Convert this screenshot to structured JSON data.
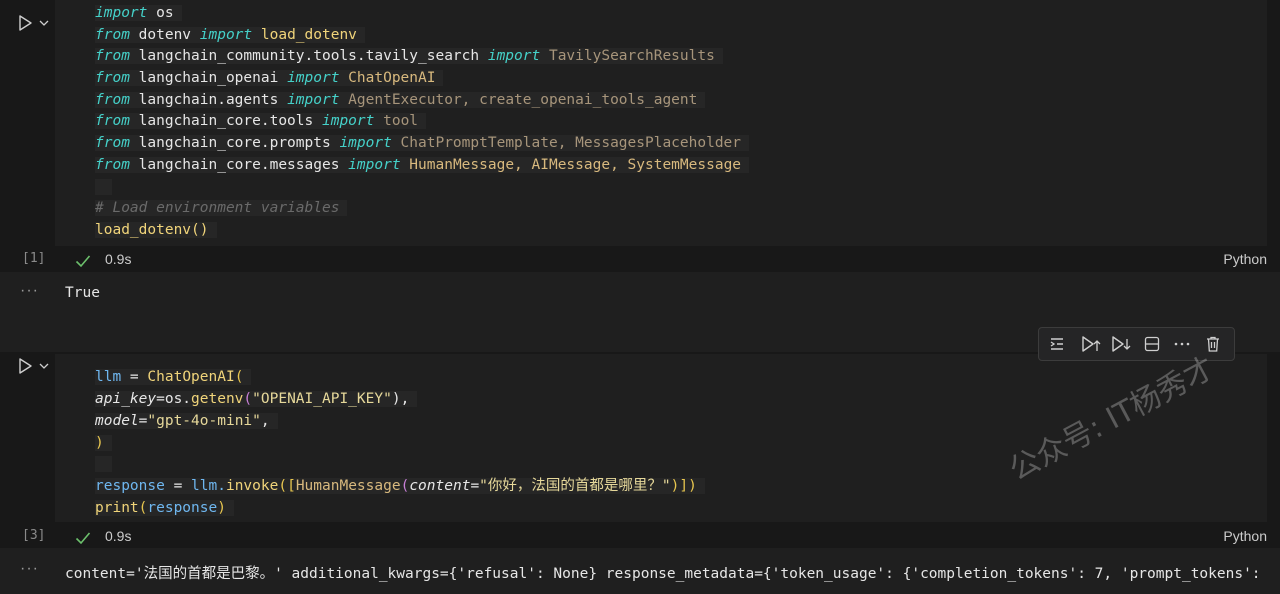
{
  "cell1": {
    "lines": [
      {
        "a": "import",
        "b": " os"
      },
      {
        "a": "from",
        "b": " dotenv ",
        "c": "import",
        "d": " load_dotenv"
      },
      {
        "a": "from",
        "b": " langchain_community.tools.tavily_search ",
        "c": "import",
        "d": " TavilySearchResults"
      },
      {
        "a": "from",
        "b": " langchain_openai ",
        "c": "import",
        "d": " ChatOpenAI"
      },
      {
        "a": "from",
        "b": " langchain.agents ",
        "c": "import",
        "d": " AgentExecutor, create_openai_tools_agent"
      },
      {
        "a": "from",
        "b": " langchain_core.tools ",
        "c": "import",
        "d": " tool"
      },
      {
        "a": "from",
        "b": " langchain_core.prompts ",
        "c": "import",
        "d": " ChatPromptTemplate, MessagesPlaceholder"
      },
      {
        "a": "from",
        "b": " langchain_core.messages ",
        "c": "import",
        "d": " HumanMessage, AIMessage, SystemMessage"
      }
    ],
    "comment": "# Load environment variables",
    "call": "load_dotenv()",
    "exec_count": "[1]",
    "duration": "0.9s",
    "language": "Python",
    "output_marker": "···",
    "output": "True"
  },
  "cell2": {
    "l1_var": "llm",
    "l1_op": " = ",
    "l1_fn": "ChatOpenAI",
    "l1_br": "(",
    "l2_param": "api_key",
    "l2_eq": "=os.",
    "l2_fn": "getenv",
    "l2_br": "(",
    "l2_str": "\"OPENAI_API_KEY\"",
    "l2_end": "),",
    "l3_param": "model",
    "l3_eq": "=",
    "l3_str": "\"gpt-4o-mini\"",
    "l3_end": ",",
    "l4": ")",
    "l5_var": "response",
    "l5_op": " = ",
    "l5_obj": "llm.",
    "l5_fn": "invoke",
    "l5_br1": "([",
    "l5_cls": "HumanMessage",
    "l5_br2": "(",
    "l5_param": "content",
    "l5_eq": "=",
    "l5_str": "\"你好，法国的首都是哪里？\"",
    "l5_end": ")])",
    "l6_fn": "print",
    "l6_br": "(",
    "l6_var": "response",
    "l6_end": ")",
    "exec_count": "[3]",
    "duration": "0.9s",
    "language": "Python",
    "output_marker": "···",
    "output": "content='法国的首都是巴黎。' additional_kwargs={'refusal': None} response_metadata={'token_usage': {'completion_tokens': 7, 'prompt_tokens':"
  },
  "watermark": "公众号: IT杨秀才",
  "icons": [
    "run-icon",
    "chevron-down-icon",
    "check-icon",
    "run-by-line-icon",
    "execute-above-icon",
    "execute-below-icon",
    "split-cell-icon",
    "more-icon",
    "delete-icon"
  ]
}
